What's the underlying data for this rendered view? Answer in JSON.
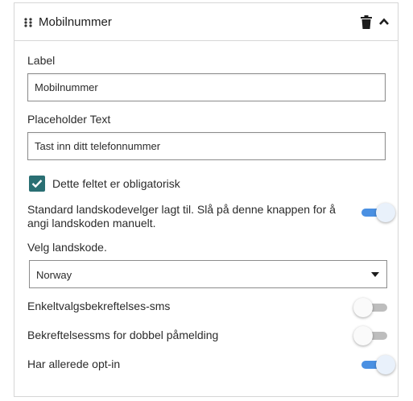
{
  "header": {
    "title": "Mobilnummer",
    "icons": [
      "drag-handle-icon",
      "trash-icon",
      "chevron-up-icon"
    ]
  },
  "label_field": {
    "label": "Label",
    "value": "Mobilnummer"
  },
  "placeholder_field": {
    "label": "Placeholder Text",
    "value": "Tast inn ditt telefonnummer"
  },
  "required": {
    "label": "Dette feltet er obligatorisk",
    "checked": true
  },
  "country_code_toggle": {
    "label": "Standard landskodevelger lagt til. Slå på denne knappen for å angi landskoden manuelt.",
    "on": true
  },
  "country_select": {
    "label": "Velg landskode.",
    "selected": "Norway"
  },
  "toggles": [
    {
      "label": "Enkeltvalgsbekreftelses-sms",
      "on": false
    },
    {
      "label": "Bekreftelsessms for dobbel påmelding",
      "on": false
    },
    {
      "label": "Har allerede opt-in",
      "on": true
    }
  ],
  "colors": {
    "accent": "#4a90e2",
    "checkbox": "#2a6f73",
    "border": "#d6d6d6"
  }
}
